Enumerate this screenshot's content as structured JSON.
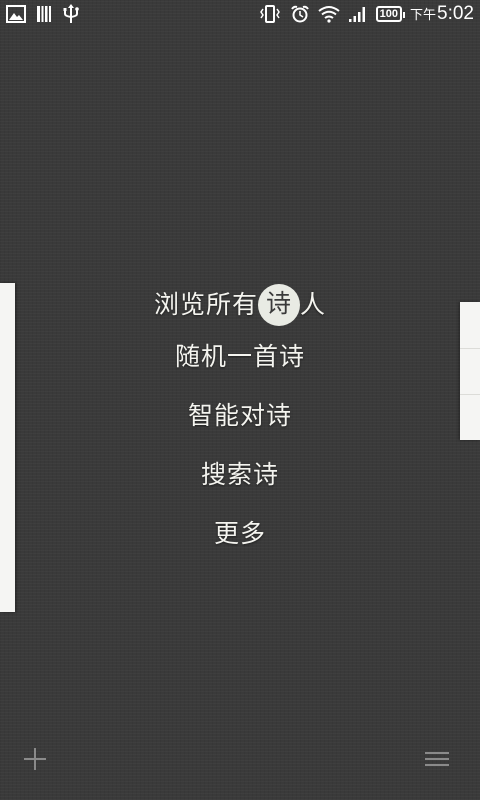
{
  "status_bar": {
    "battery": "100",
    "ampm": "下午",
    "time": "5:02",
    "left_icons": [
      "image-icon",
      "barcode-icon",
      "usb-icon"
    ],
    "right_icons": [
      "vibrate-icon",
      "alarm-icon",
      "wifi-icon",
      "signal-icon",
      "battery-icon"
    ]
  },
  "menu": {
    "browse_prefix": "浏览所有",
    "browse_highlight": "诗",
    "browse_suffix": "人",
    "random_poem": "随机一首诗",
    "smart_couplet": "智能对诗",
    "search_poem": "搜索诗",
    "more": "更多"
  },
  "bottom_bar": {
    "left_icon": "plus-icon",
    "right_icon": "hamburger-menu-icon"
  },
  "colors": {
    "background": "#3a3a3a",
    "text": "#f4f4ef",
    "highlight_circle": "#e9ebe4",
    "panel": "#f5f5f3"
  }
}
